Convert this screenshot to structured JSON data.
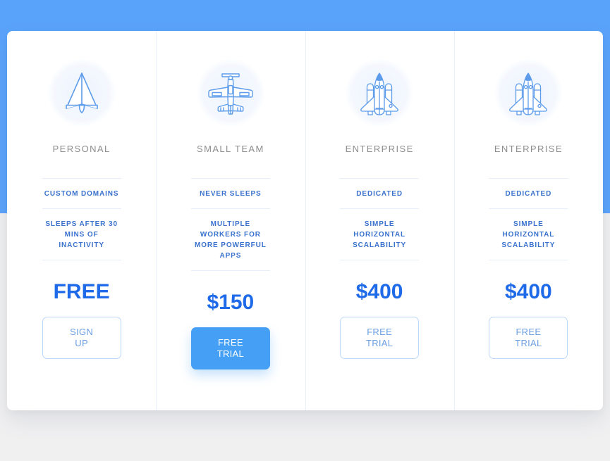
{
  "background": {
    "hero_color": "#5aa3fb",
    "page_color": "#f0f0f1",
    "card_color": "#ffffff"
  },
  "theme": {
    "accent": "#45a0f5",
    "price_color": "#1f6ae8",
    "feature_color": "#3a72cd",
    "title_color": "#8d8d8d",
    "outline_border": "#bcd8f7",
    "outline_text": "#6b9ee2",
    "divider": "#e6eefa"
  },
  "plans": [
    {
      "icon": "paper-plane-icon",
      "title": "PERSONAL",
      "features": [
        "CUSTOM DOMAINS",
        "SLEEPS AFTER 30 MINS OF INACTIVITY"
      ],
      "price": "FREE",
      "cta_line1": "SIGN",
      "cta_line2": "UP",
      "cta_style": "outline"
    },
    {
      "icon": "propeller-plane-icon",
      "title": "SMALL TEAM",
      "features": [
        "NEVER SLEEPS",
        "MULTIPLE WORKERS FOR MORE POWERFUL APPS"
      ],
      "price": "$150",
      "cta_line1": "FREE",
      "cta_line2": "TRIAL",
      "cta_style": "filled"
    },
    {
      "icon": "space-shuttle-icon",
      "title": "ENTERPRISE",
      "features": [
        "DEDICATED",
        "SIMPLE HORIZONTAL SCALABILITY"
      ],
      "price": "$400",
      "cta_line1": "FREE",
      "cta_line2": "TRIAL",
      "cta_style": "outline"
    },
    {
      "icon": "space-shuttle-icon",
      "title": "ENTERPRISE",
      "features": [
        "DEDICATED",
        "SIMPLE HORIZONTAL SCALABILITY"
      ],
      "price": "$400",
      "cta_line1": "FREE",
      "cta_line2": "TRIAL",
      "cta_style": "outline"
    }
  ]
}
